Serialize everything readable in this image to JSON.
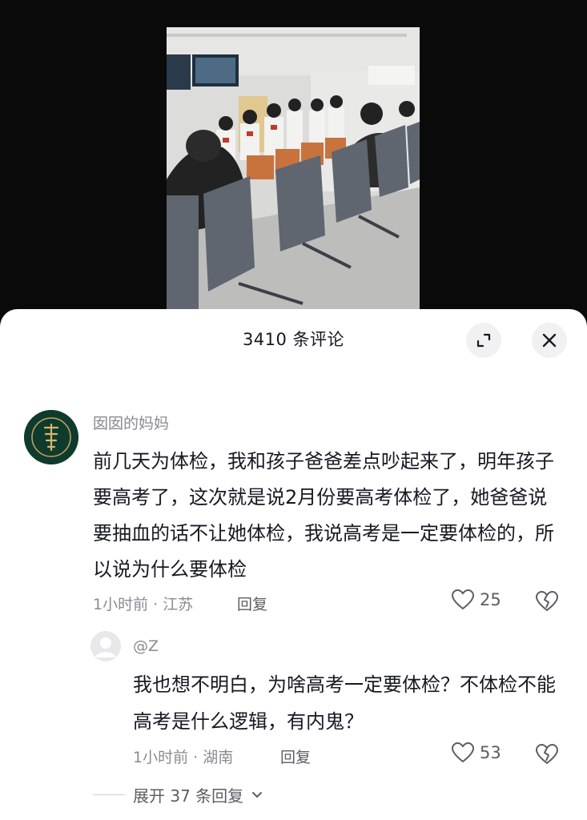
{
  "header": {
    "comment_count_title": "3410 条评论"
  },
  "comments": [
    {
      "username": "囡囡的妈妈",
      "text": "前几天为体检，我和孩子爸爸差点吵起来了，明年孩子要高考了，这次就是说2月份要高考体检了，她爸爸说要抽血的话不让她体检，我说高考是一定要体检的，所以说为什么要体检",
      "meta": "1小时前 · 江苏",
      "reply_label": "回复",
      "likes": "25",
      "avatar_icon": "seal-avatar-icon"
    }
  ],
  "replies": [
    {
      "username": "@Z",
      "text": "我也想不明白，为啥高考一定要体检？不体检不能高考是什么逻辑，有内鬼？",
      "meta": "1小时前 · 湖南",
      "reply_label": "回复",
      "likes": "53",
      "avatar_icon": "default-user-icon"
    }
  ],
  "expand_replies_label": "展开 37 条回复",
  "icons": {
    "expand": "expand-fullscreen-icon",
    "close": "close-icon",
    "like": "heart-icon",
    "dislike": "broken-heart-icon",
    "chevron": "chevron-down-icon"
  },
  "colors": {
    "sheet_bg": "#ffffff",
    "text_primary": "#161823",
    "text_secondary": "#8a8b91"
  }
}
